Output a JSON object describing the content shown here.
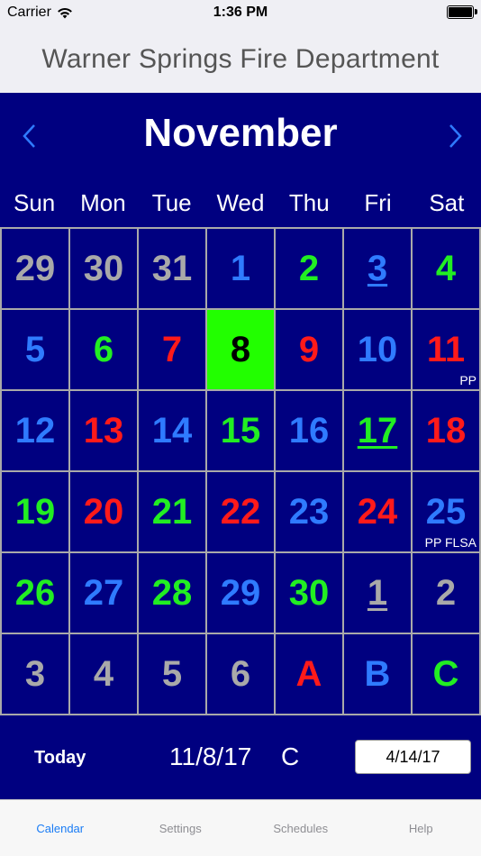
{
  "status_bar": {
    "carrier": "Carrier",
    "time": "1:36 PM"
  },
  "header": {
    "title": "Warner Springs Fire Department"
  },
  "calendar": {
    "month": "November",
    "weekdays": [
      "Sun",
      "Mon",
      "Tue",
      "Wed",
      "Thu",
      "Fri",
      "Sat"
    ],
    "colors": {
      "gray": "#a9a9a9",
      "blue": "#2f7bff",
      "green": "#22ee22",
      "red": "#ff1a1a",
      "black": "#000000",
      "today_bg": "#22ff00",
      "background": "#000080"
    },
    "days": [
      {
        "label": "29",
        "color": "gray"
      },
      {
        "label": "30",
        "color": "gray"
      },
      {
        "label": "31",
        "color": "gray"
      },
      {
        "label": "1",
        "color": "blue"
      },
      {
        "label": "2",
        "color": "green"
      },
      {
        "label": "3",
        "color": "blue",
        "underline": true
      },
      {
        "label": "4",
        "color": "green"
      },
      {
        "label": "5",
        "color": "blue"
      },
      {
        "label": "6",
        "color": "green"
      },
      {
        "label": "7",
        "color": "red"
      },
      {
        "label": "8",
        "color": "black",
        "today": true
      },
      {
        "label": "9",
        "color": "red"
      },
      {
        "label": "10",
        "color": "blue"
      },
      {
        "label": "11",
        "color": "red",
        "note": "PP"
      },
      {
        "label": "12",
        "color": "blue"
      },
      {
        "label": "13",
        "color": "red"
      },
      {
        "label": "14",
        "color": "blue"
      },
      {
        "label": "15",
        "color": "green"
      },
      {
        "label": "16",
        "color": "blue"
      },
      {
        "label": "17",
        "color": "green",
        "underline": true
      },
      {
        "label": "18",
        "color": "red"
      },
      {
        "label": "19",
        "color": "green"
      },
      {
        "label": "20",
        "color": "red"
      },
      {
        "label": "21",
        "color": "green"
      },
      {
        "label": "22",
        "color": "red"
      },
      {
        "label": "23",
        "color": "blue"
      },
      {
        "label": "24",
        "color": "red"
      },
      {
        "label": "25",
        "color": "blue",
        "note": "PP FLSA"
      },
      {
        "label": "26",
        "color": "green"
      },
      {
        "label": "27",
        "color": "blue"
      },
      {
        "label": "28",
        "color": "green"
      },
      {
        "label": "29",
        "color": "blue"
      },
      {
        "label": "30",
        "color": "green"
      },
      {
        "label": "1",
        "color": "gray",
        "underline": true
      },
      {
        "label": "2",
        "color": "gray"
      },
      {
        "label": "3",
        "color": "gray"
      },
      {
        "label": "4",
        "color": "gray"
      },
      {
        "label": "5",
        "color": "gray"
      },
      {
        "label": "6",
        "color": "gray"
      },
      {
        "label": "A",
        "color": "red"
      },
      {
        "label": "B",
        "color": "blue"
      },
      {
        "label": "C",
        "color": "green"
      }
    ]
  },
  "footer": {
    "today_label": "Today",
    "current_date": "11/8/17",
    "current_shift": "C",
    "date_field_value": "4/14/17"
  },
  "tabs": [
    {
      "label": "Calendar",
      "active": true
    },
    {
      "label": "Settings"
    },
    {
      "label": "Schedules"
    },
    {
      "label": "Help"
    }
  ],
  "icons": {
    "prev": "chevron-left-icon",
    "next": "chevron-right-icon",
    "wifi": "wifi-icon",
    "battery": "battery-icon"
  }
}
